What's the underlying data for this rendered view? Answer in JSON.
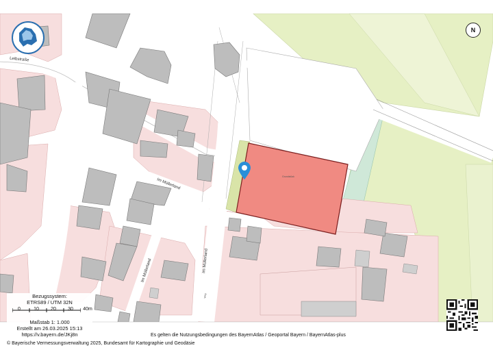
{
  "map": {
    "street_labels": [
      "Leibstraße",
      "Im Müllerland",
      "Im Müllerland",
      "Im Müllerland"
    ],
    "parcel_labels": [
      "Grundstück",
      "Weg"
    ],
    "north_label": "N",
    "colors": {
      "highlight_parcel": "#f08a82",
      "highlight_border": "#7a1e1e",
      "residential": "#f7dede",
      "green_area": "#e6f0c4",
      "teal_area": "#cfe8d8",
      "building": "#b9b9b9",
      "street": "#ffffff",
      "pin": "#2a8fd8"
    }
  },
  "scale": {
    "reference_system_label": "Bezugssystem:",
    "reference_system": "ETRS89 / UTM 32N",
    "ticks": [
      "0",
      "10",
      "20",
      "30",
      "40m"
    ],
    "scale_ratio": "Maßstab 1: 1.000",
    "created": "Erstellt am 26.03.2025 15:13",
    "url": "https://v.bayern.de/JKj8n"
  },
  "footer": {
    "terms": "Es gelten die Nutzungsbedingungen des BayernAtlas / Geoportal Bayern / BayernAtlas-plus",
    "copyright": "© Bayerische Vermessungsverwaltung 2025, Bundesamt für Kartographie und Geodäsie"
  },
  "icons": [
    "bavaria-logo-icon",
    "north-arrow-icon",
    "location-pin-icon",
    "qr-code-icon"
  ]
}
